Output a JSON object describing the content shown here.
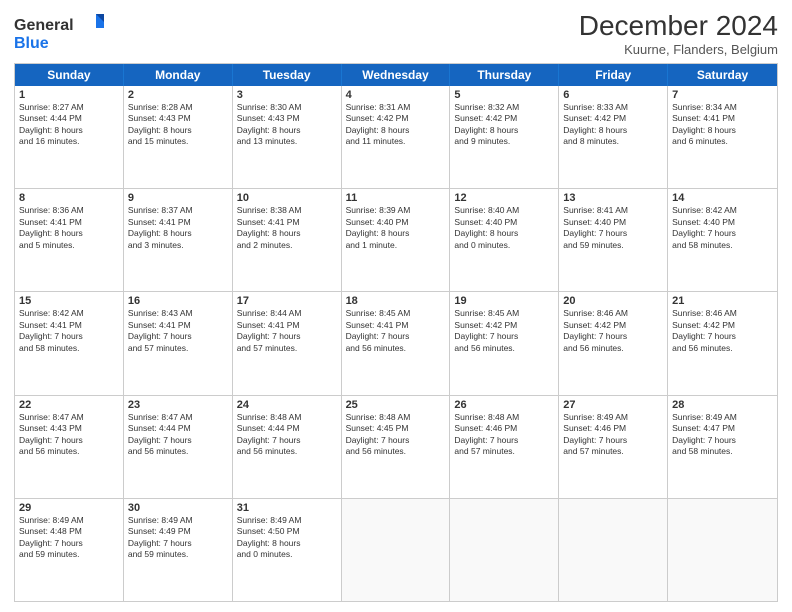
{
  "logo": {
    "line1": "General",
    "line2": "Blue"
  },
  "title": "December 2024",
  "location": "Kuurne, Flanders, Belgium",
  "header_days": [
    "Sunday",
    "Monday",
    "Tuesday",
    "Wednesday",
    "Thursday",
    "Friday",
    "Saturday"
  ],
  "weeks": [
    [
      {
        "day": "1",
        "lines": [
          "Sunrise: 8:27 AM",
          "Sunset: 4:44 PM",
          "Daylight: 8 hours",
          "and 16 minutes."
        ]
      },
      {
        "day": "2",
        "lines": [
          "Sunrise: 8:28 AM",
          "Sunset: 4:43 PM",
          "Daylight: 8 hours",
          "and 15 minutes."
        ]
      },
      {
        "day": "3",
        "lines": [
          "Sunrise: 8:30 AM",
          "Sunset: 4:43 PM",
          "Daylight: 8 hours",
          "and 13 minutes."
        ]
      },
      {
        "day": "4",
        "lines": [
          "Sunrise: 8:31 AM",
          "Sunset: 4:42 PM",
          "Daylight: 8 hours",
          "and 11 minutes."
        ]
      },
      {
        "day": "5",
        "lines": [
          "Sunrise: 8:32 AM",
          "Sunset: 4:42 PM",
          "Daylight: 8 hours",
          "and 9 minutes."
        ]
      },
      {
        "day": "6",
        "lines": [
          "Sunrise: 8:33 AM",
          "Sunset: 4:42 PM",
          "Daylight: 8 hours",
          "and 8 minutes."
        ]
      },
      {
        "day": "7",
        "lines": [
          "Sunrise: 8:34 AM",
          "Sunset: 4:41 PM",
          "Daylight: 8 hours",
          "and 6 minutes."
        ]
      }
    ],
    [
      {
        "day": "8",
        "lines": [
          "Sunrise: 8:36 AM",
          "Sunset: 4:41 PM",
          "Daylight: 8 hours",
          "and 5 minutes."
        ]
      },
      {
        "day": "9",
        "lines": [
          "Sunrise: 8:37 AM",
          "Sunset: 4:41 PM",
          "Daylight: 8 hours",
          "and 3 minutes."
        ]
      },
      {
        "day": "10",
        "lines": [
          "Sunrise: 8:38 AM",
          "Sunset: 4:41 PM",
          "Daylight: 8 hours",
          "and 2 minutes."
        ]
      },
      {
        "day": "11",
        "lines": [
          "Sunrise: 8:39 AM",
          "Sunset: 4:40 PM",
          "Daylight: 8 hours",
          "and 1 minute."
        ]
      },
      {
        "day": "12",
        "lines": [
          "Sunrise: 8:40 AM",
          "Sunset: 4:40 PM",
          "Daylight: 8 hours",
          "and 0 minutes."
        ]
      },
      {
        "day": "13",
        "lines": [
          "Sunrise: 8:41 AM",
          "Sunset: 4:40 PM",
          "Daylight: 7 hours",
          "and 59 minutes."
        ]
      },
      {
        "day": "14",
        "lines": [
          "Sunrise: 8:42 AM",
          "Sunset: 4:40 PM",
          "Daylight: 7 hours",
          "and 58 minutes."
        ]
      }
    ],
    [
      {
        "day": "15",
        "lines": [
          "Sunrise: 8:42 AM",
          "Sunset: 4:41 PM",
          "Daylight: 7 hours",
          "and 58 minutes."
        ]
      },
      {
        "day": "16",
        "lines": [
          "Sunrise: 8:43 AM",
          "Sunset: 4:41 PM",
          "Daylight: 7 hours",
          "and 57 minutes."
        ]
      },
      {
        "day": "17",
        "lines": [
          "Sunrise: 8:44 AM",
          "Sunset: 4:41 PM",
          "Daylight: 7 hours",
          "and 57 minutes."
        ]
      },
      {
        "day": "18",
        "lines": [
          "Sunrise: 8:45 AM",
          "Sunset: 4:41 PM",
          "Daylight: 7 hours",
          "and 56 minutes."
        ]
      },
      {
        "day": "19",
        "lines": [
          "Sunrise: 8:45 AM",
          "Sunset: 4:42 PM",
          "Daylight: 7 hours",
          "and 56 minutes."
        ]
      },
      {
        "day": "20",
        "lines": [
          "Sunrise: 8:46 AM",
          "Sunset: 4:42 PM",
          "Daylight: 7 hours",
          "and 56 minutes."
        ]
      },
      {
        "day": "21",
        "lines": [
          "Sunrise: 8:46 AM",
          "Sunset: 4:42 PM",
          "Daylight: 7 hours",
          "and 56 minutes."
        ]
      }
    ],
    [
      {
        "day": "22",
        "lines": [
          "Sunrise: 8:47 AM",
          "Sunset: 4:43 PM",
          "Daylight: 7 hours",
          "and 56 minutes."
        ]
      },
      {
        "day": "23",
        "lines": [
          "Sunrise: 8:47 AM",
          "Sunset: 4:44 PM",
          "Daylight: 7 hours",
          "and 56 minutes."
        ]
      },
      {
        "day": "24",
        "lines": [
          "Sunrise: 8:48 AM",
          "Sunset: 4:44 PM",
          "Daylight: 7 hours",
          "and 56 minutes."
        ]
      },
      {
        "day": "25",
        "lines": [
          "Sunrise: 8:48 AM",
          "Sunset: 4:45 PM",
          "Daylight: 7 hours",
          "and 56 minutes."
        ]
      },
      {
        "day": "26",
        "lines": [
          "Sunrise: 8:48 AM",
          "Sunset: 4:46 PM",
          "Daylight: 7 hours",
          "and 57 minutes."
        ]
      },
      {
        "day": "27",
        "lines": [
          "Sunrise: 8:49 AM",
          "Sunset: 4:46 PM",
          "Daylight: 7 hours",
          "and 57 minutes."
        ]
      },
      {
        "day": "28",
        "lines": [
          "Sunrise: 8:49 AM",
          "Sunset: 4:47 PM",
          "Daylight: 7 hours",
          "and 58 minutes."
        ]
      }
    ],
    [
      {
        "day": "29",
        "lines": [
          "Sunrise: 8:49 AM",
          "Sunset: 4:48 PM",
          "Daylight: 7 hours",
          "and 59 minutes."
        ]
      },
      {
        "day": "30",
        "lines": [
          "Sunrise: 8:49 AM",
          "Sunset: 4:49 PM",
          "Daylight: 7 hours",
          "and 59 minutes."
        ]
      },
      {
        "day": "31",
        "lines": [
          "Sunrise: 8:49 AM",
          "Sunset: 4:50 PM",
          "Daylight: 8 hours",
          "and 0 minutes."
        ]
      },
      {
        "day": "",
        "lines": []
      },
      {
        "day": "",
        "lines": []
      },
      {
        "day": "",
        "lines": []
      },
      {
        "day": "",
        "lines": []
      }
    ]
  ]
}
